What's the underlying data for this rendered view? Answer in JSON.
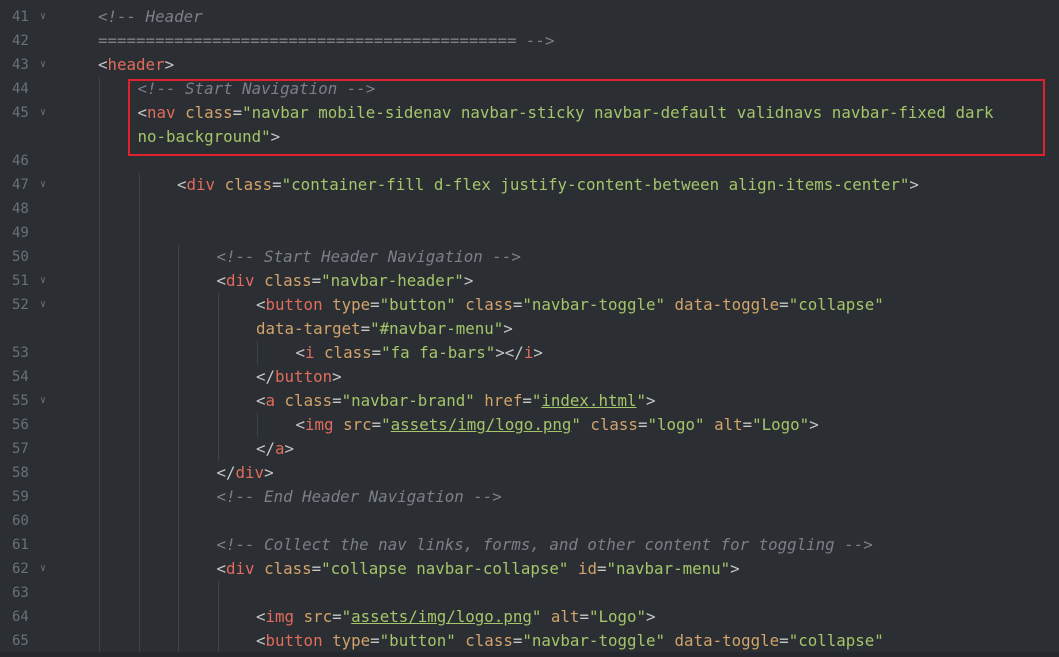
{
  "lines": [
    {
      "num": "41",
      "fold": true,
      "indent": 0,
      "tokens": [
        {
          "t": "comment",
          "v": "<!-- Header"
        }
      ]
    },
    {
      "num": "42",
      "fold": false,
      "indent": 0,
      "tokens": [
        {
          "t": "comment",
          "v": "============================================ -->"
        }
      ]
    },
    {
      "num": "43",
      "fold": true,
      "indent": 0,
      "tokens": [
        {
          "t": "punct",
          "v": "<"
        },
        {
          "t": "tag",
          "v": "header"
        },
        {
          "t": "punct",
          "v": ">"
        }
      ]
    },
    {
      "num": "44",
      "fold": false,
      "indent": 1,
      "tokens": [
        {
          "t": "comment",
          "v": "<!-- Start Navigation -->"
        }
      ]
    },
    {
      "num": "45",
      "fold": true,
      "indent": 1,
      "tokens": [
        {
          "t": "punct",
          "v": "<"
        },
        {
          "t": "tag",
          "v": "nav"
        },
        {
          "t": "text",
          "v": " "
        },
        {
          "t": "attr",
          "v": "class"
        },
        {
          "t": "eq",
          "v": "="
        },
        {
          "t": "str",
          "v": "\"navbar mobile-sidenav navbar-sticky navbar-default validnavs navbar-fixed dark"
        }
      ]
    },
    {
      "num": "",
      "fold": false,
      "indent": 1,
      "tokens": [
        {
          "t": "str",
          "v": "no-background\""
        },
        {
          "t": "punct",
          "v": ">"
        }
      ]
    },
    {
      "num": "46",
      "fold": false,
      "indent": 1,
      "tokens": []
    },
    {
      "num": "47",
      "fold": true,
      "indent": 2,
      "tokens": [
        {
          "t": "punct",
          "v": "<"
        },
        {
          "t": "tag",
          "v": "div"
        },
        {
          "t": "text",
          "v": " "
        },
        {
          "t": "attr",
          "v": "class"
        },
        {
          "t": "eq",
          "v": "="
        },
        {
          "t": "str",
          "v": "\"container-fill d-flex justify-content-between align-items-center\""
        },
        {
          "t": "punct",
          "v": ">"
        }
      ]
    },
    {
      "num": "48",
      "fold": false,
      "indent": 2,
      "tokens": []
    },
    {
      "num": "49",
      "fold": false,
      "indent": 2,
      "tokens": []
    },
    {
      "num": "50",
      "fold": false,
      "indent": 3,
      "tokens": [
        {
          "t": "comment",
          "v": "<!-- Start Header Navigation -->"
        }
      ]
    },
    {
      "num": "51",
      "fold": true,
      "indent": 3,
      "tokens": [
        {
          "t": "punct",
          "v": "<"
        },
        {
          "t": "tag",
          "v": "div"
        },
        {
          "t": "text",
          "v": " "
        },
        {
          "t": "attr",
          "v": "class"
        },
        {
          "t": "eq",
          "v": "="
        },
        {
          "t": "str",
          "v": "\"navbar-header\""
        },
        {
          "t": "punct",
          "v": ">"
        }
      ]
    },
    {
      "num": "52",
      "fold": true,
      "indent": 4,
      "tokens": [
        {
          "t": "punct",
          "v": "<"
        },
        {
          "t": "tag",
          "v": "button"
        },
        {
          "t": "text",
          "v": " "
        },
        {
          "t": "attr",
          "v": "type"
        },
        {
          "t": "eq",
          "v": "="
        },
        {
          "t": "str",
          "v": "\"button\""
        },
        {
          "t": "text",
          "v": " "
        },
        {
          "t": "attr",
          "v": "class"
        },
        {
          "t": "eq",
          "v": "="
        },
        {
          "t": "str",
          "v": "\"navbar-toggle\""
        },
        {
          "t": "text",
          "v": " "
        },
        {
          "t": "attr",
          "v": "data-toggle"
        },
        {
          "t": "eq",
          "v": "="
        },
        {
          "t": "str",
          "v": "\"collapse\""
        }
      ]
    },
    {
      "num": "",
      "fold": false,
      "indent": 4,
      "tokens": [
        {
          "t": "attr",
          "v": "data-target"
        },
        {
          "t": "eq",
          "v": "="
        },
        {
          "t": "str",
          "v": "\"#navbar-menu\""
        },
        {
          "t": "punct",
          "v": ">"
        }
      ]
    },
    {
      "num": "53",
      "fold": false,
      "indent": 5,
      "tokens": [
        {
          "t": "punct",
          "v": "<"
        },
        {
          "t": "tag",
          "v": "i"
        },
        {
          "t": "text",
          "v": " "
        },
        {
          "t": "attr",
          "v": "class"
        },
        {
          "t": "eq",
          "v": "="
        },
        {
          "t": "str",
          "v": "\"fa fa-bars\""
        },
        {
          "t": "punct",
          "v": "></"
        },
        {
          "t": "tag",
          "v": "i"
        },
        {
          "t": "punct",
          "v": ">"
        }
      ]
    },
    {
      "num": "54",
      "fold": false,
      "indent": 4,
      "tokens": [
        {
          "t": "punct",
          "v": "</"
        },
        {
          "t": "tag",
          "v": "button"
        },
        {
          "t": "punct",
          "v": ">"
        }
      ]
    },
    {
      "num": "55",
      "fold": true,
      "indent": 4,
      "tokens": [
        {
          "t": "punct",
          "v": "<"
        },
        {
          "t": "tag",
          "v": "a"
        },
        {
          "t": "text",
          "v": " "
        },
        {
          "t": "attr",
          "v": "class"
        },
        {
          "t": "eq",
          "v": "="
        },
        {
          "t": "str",
          "v": "\"navbar-brand\""
        },
        {
          "t": "text",
          "v": " "
        },
        {
          "t": "attr",
          "v": "href"
        },
        {
          "t": "eq",
          "v": "="
        },
        {
          "t": "str",
          "v": "\""
        },
        {
          "t": "url",
          "v": "index.html"
        },
        {
          "t": "str",
          "v": "\""
        },
        {
          "t": "punct",
          "v": ">"
        }
      ]
    },
    {
      "num": "56",
      "fold": false,
      "indent": 5,
      "tokens": [
        {
          "t": "punct",
          "v": "<"
        },
        {
          "t": "tag",
          "v": "img"
        },
        {
          "t": "text",
          "v": " "
        },
        {
          "t": "attr",
          "v": "src"
        },
        {
          "t": "eq",
          "v": "="
        },
        {
          "t": "str",
          "v": "\""
        },
        {
          "t": "url",
          "v": "assets/img/logo.png"
        },
        {
          "t": "str",
          "v": "\""
        },
        {
          "t": "text",
          "v": " "
        },
        {
          "t": "attr",
          "v": "class"
        },
        {
          "t": "eq",
          "v": "="
        },
        {
          "t": "str",
          "v": "\"logo\""
        },
        {
          "t": "text",
          "v": " "
        },
        {
          "t": "attr",
          "v": "alt"
        },
        {
          "t": "eq",
          "v": "="
        },
        {
          "t": "str",
          "v": "\"Logo\""
        },
        {
          "t": "punct",
          "v": ">"
        }
      ]
    },
    {
      "num": "57",
      "fold": false,
      "indent": 4,
      "tokens": [
        {
          "t": "punct",
          "v": "</"
        },
        {
          "t": "tag",
          "v": "a"
        },
        {
          "t": "punct",
          "v": ">"
        }
      ]
    },
    {
      "num": "58",
      "fold": false,
      "indent": 3,
      "tokens": [
        {
          "t": "punct",
          "v": "</"
        },
        {
          "t": "tag",
          "v": "div"
        },
        {
          "t": "punct",
          "v": ">"
        }
      ]
    },
    {
      "num": "59",
      "fold": false,
      "indent": 3,
      "tokens": [
        {
          "t": "comment",
          "v": "<!-- End Header Navigation -->"
        }
      ]
    },
    {
      "num": "60",
      "fold": false,
      "indent": 3,
      "tokens": []
    },
    {
      "num": "61",
      "fold": false,
      "indent": 3,
      "tokens": [
        {
          "t": "comment",
          "v": "<!-- Collect the nav links, forms, and other content for toggling -->"
        }
      ]
    },
    {
      "num": "62",
      "fold": true,
      "indent": 3,
      "tokens": [
        {
          "t": "punct",
          "v": "<"
        },
        {
          "t": "tag",
          "v": "div"
        },
        {
          "t": "text",
          "v": " "
        },
        {
          "t": "attr",
          "v": "class"
        },
        {
          "t": "eq",
          "v": "="
        },
        {
          "t": "str",
          "v": "\"collapse navbar-collapse\""
        },
        {
          "t": "text",
          "v": " "
        },
        {
          "t": "attr",
          "v": "id"
        },
        {
          "t": "eq",
          "v": "="
        },
        {
          "t": "str",
          "v": "\"navbar-menu\""
        },
        {
          "t": "punct",
          "v": ">"
        }
      ]
    },
    {
      "num": "63",
      "fold": false,
      "indent": 4,
      "tokens": []
    },
    {
      "num": "64",
      "fold": false,
      "indent": 4,
      "tokens": [
        {
          "t": "punct",
          "v": "<"
        },
        {
          "t": "tag",
          "v": "img"
        },
        {
          "t": "text",
          "v": " "
        },
        {
          "t": "attr",
          "v": "src"
        },
        {
          "t": "eq",
          "v": "="
        },
        {
          "t": "str",
          "v": "\""
        },
        {
          "t": "url",
          "v": "assets/img/logo.png"
        },
        {
          "t": "str",
          "v": "\""
        },
        {
          "t": "text",
          "v": " "
        },
        {
          "t": "attr",
          "v": "alt"
        },
        {
          "t": "eq",
          "v": "="
        },
        {
          "t": "str",
          "v": "\"Logo\""
        },
        {
          "t": "punct",
          "v": ">"
        }
      ]
    },
    {
      "num": "65",
      "fold": false,
      "indent": 4,
      "tokens": [
        {
          "t": "punct",
          "v": "<"
        },
        {
          "t": "tag",
          "v": "button"
        },
        {
          "t": "text",
          "v": " "
        },
        {
          "t": "attr",
          "v": "type"
        },
        {
          "t": "eq",
          "v": "="
        },
        {
          "t": "str",
          "v": "\"button\""
        },
        {
          "t": "text",
          "v": " "
        },
        {
          "t": "attr",
          "v": "class"
        },
        {
          "t": "eq",
          "v": "="
        },
        {
          "t": "str",
          "v": "\"navbar-toggle\""
        },
        {
          "t": "text",
          "v": " "
        },
        {
          "t": "attr",
          "v": "data-toggle"
        },
        {
          "t": "eq",
          "v": "="
        },
        {
          "t": "str",
          "v": "\"collapse\""
        }
      ]
    }
  ],
  "highlight": {
    "color": "#e0202a",
    "from_line": "44",
    "to_line": "45"
  }
}
